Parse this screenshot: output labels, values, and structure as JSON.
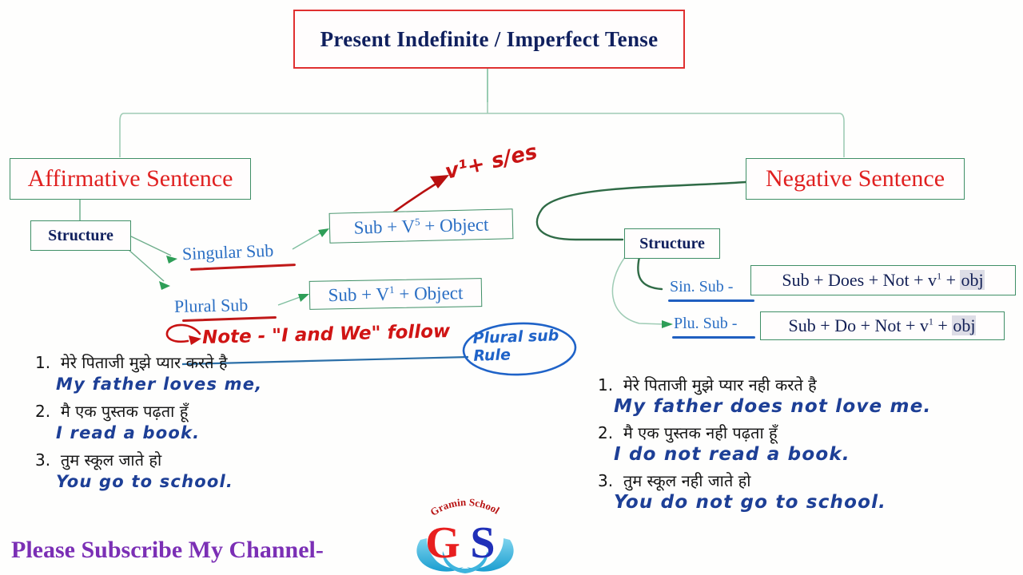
{
  "title": "Present Indefinite  /  Imperfect Tense",
  "branches": {
    "affirmative": {
      "heading": "Affirmative Sentence",
      "structure_label": "Structure",
      "rows": [
        {
          "sub_label": "Singular Sub",
          "formula": "Sub + V5 + Object"
        },
        {
          "sub_label": "Plural Sub",
          "formula": "Sub + V1 + Object"
        }
      ],
      "annotation": "v¹+ s/es",
      "examples": [
        {
          "num": "1.",
          "hindi": "मेरे पिताजी मुझे प्यार करते है",
          "english": "My father loves me,"
        },
        {
          "num": "2.",
          "hindi": "मै एक पुस्तक पढ़ता हूँ",
          "english": "I read a book."
        },
        {
          "num": "3.",
          "hindi": "तुम स्कूल जाते हो",
          "english": "You go to school."
        }
      ]
    },
    "negative": {
      "heading": "Negative Sentence",
      "structure_label": "Structure",
      "rows": [
        {
          "sub_label": "Sin. Sub -",
          "formula_prefix": "Sub + Does + Not + v",
          "formula_sup": "1",
          "formula_mid": " + ",
          "formula_obj": "obj"
        },
        {
          "sub_label": "Plu. Sub -",
          "formula_prefix": "Sub + Do + Not + v",
          "formula_sup": "1",
          "formula_mid": " + ",
          "formula_obj": "obj"
        }
      ],
      "examples": [
        {
          "num": "1.",
          "hindi": "मेरे पिताजी मुझे प्यार नही करते है",
          "english": "My father does not love me."
        },
        {
          "num": "2.",
          "hindi": "मै एक पुस्तक नही पढ़ता हूँ",
          "english": "I do not read a book."
        },
        {
          "num": "3.",
          "hindi": "तुम स्कूल नही जाते हो",
          "english": "You do not go to school."
        }
      ]
    }
  },
  "note": {
    "text": "Note - \"I and We\" follow",
    "callout_line1": "Plural sub",
    "callout_line2": "Rule"
  },
  "footer": {
    "subscribe": "Please Subscribe My Channel-",
    "logo_arc": "Gramin School",
    "logo_g": "G",
    "logo_s": "S"
  },
  "colors": {
    "title_text": "#10205e",
    "title_border": "#e03030",
    "heading_red": "#e02020",
    "box_green": "#3f8f66",
    "blue_text": "#2b6fc4",
    "hand_blue": "#1d3f96",
    "hand_red": "#d01414",
    "purple": "#7b2fb5",
    "background": "#fefefd"
  }
}
